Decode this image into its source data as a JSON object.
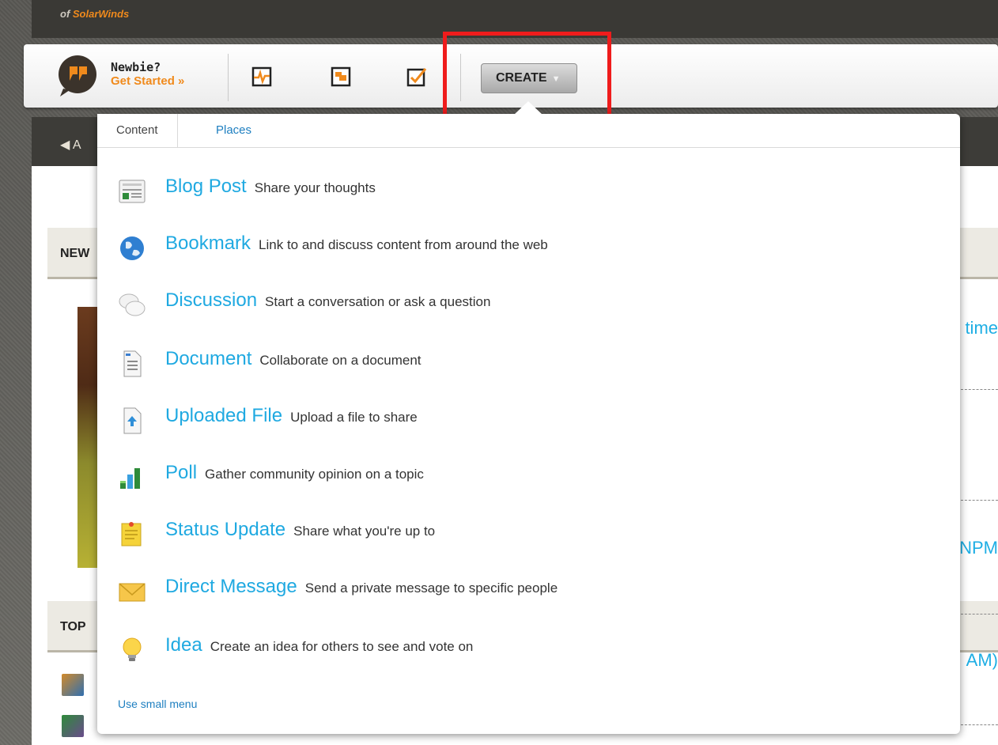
{
  "brand": {
    "sub_prefix": "of ",
    "sub_highlight": "SolarWinds"
  },
  "header": {
    "newbie_line1": "Newbie?",
    "newbie_line2": "Get Started »",
    "create_label": "CREATE"
  },
  "background": {
    "nav_fragment": "A",
    "section1": "NEW",
    "section2": "TOP",
    "right_frag_1": "time",
    "right_frag_2": "NPM",
    "right_frag_3": "AM)"
  },
  "menu": {
    "tabs": [
      {
        "label": "Content",
        "active": true
      },
      {
        "label": "Places",
        "active": false
      }
    ],
    "items": [
      {
        "name": "Blog Post",
        "desc": "Share your thoughts",
        "icon": "blog-post-icon"
      },
      {
        "name": "Bookmark",
        "desc": "Link to and discuss content from around the web",
        "icon": "globe-icon"
      },
      {
        "name": "Discussion",
        "desc": "Start a conversation or ask a question",
        "icon": "speech-bubbles-icon"
      },
      {
        "name": "Document",
        "desc": "Collaborate on a document",
        "icon": "document-icon"
      },
      {
        "name": "Uploaded File",
        "desc": "Upload a file to share",
        "icon": "upload-file-icon"
      },
      {
        "name": "Poll",
        "desc": "Gather community opinion on a topic",
        "icon": "bar-chart-icon"
      },
      {
        "name": "Status Update",
        "desc": "Share what you're up to",
        "icon": "sticky-note-icon"
      },
      {
        "name": "Direct Message",
        "desc": "Send a private message to specific people",
        "icon": "envelope-icon"
      },
      {
        "name": "Idea",
        "desc": "Create an idea for others to see and vote on",
        "icon": "lightbulb-icon"
      }
    ],
    "footer_link": "Use small menu"
  },
  "colors": {
    "accent_blue": "#1fa9e1",
    "link_blue": "#1e7fc0",
    "brand_orange": "#f08a1c",
    "highlight_red": "#ef1c1c"
  }
}
